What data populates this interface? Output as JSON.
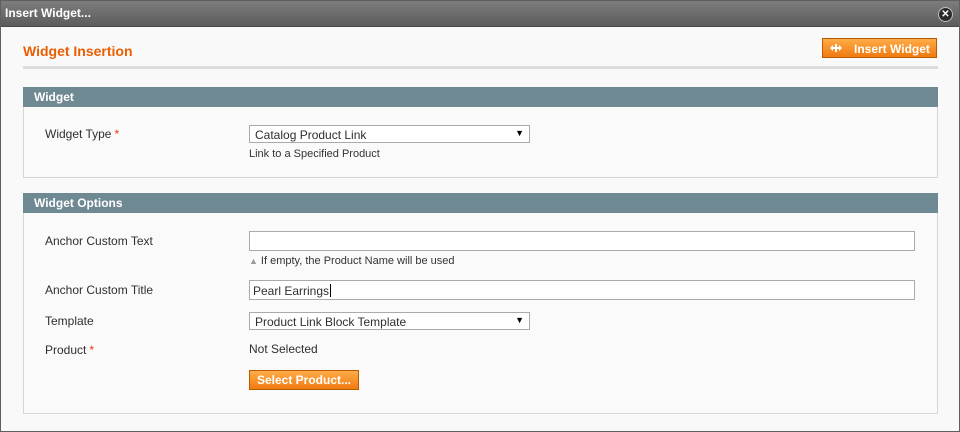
{
  "window": {
    "title": "Insert Widget...",
    "close_icon": "close-icon"
  },
  "header": {
    "title": "Widget Insertion",
    "insert_button_label": "Insert Widget",
    "insert_icon": "move-arrows-icon"
  },
  "widget_section": {
    "title": "Widget",
    "widget_type_label": "Widget Type",
    "required_mark": "*",
    "widget_type_value": "Catalog Product Link",
    "widget_type_note": "Link to a Specified Product"
  },
  "options_section": {
    "title": "Widget Options",
    "anchor_text_label": "Anchor Custom Text",
    "anchor_text_value": "",
    "anchor_text_note": "If empty, the Product Name will be used",
    "anchor_title_label": "Anchor Custom Title",
    "anchor_title_value": "Pearl Earrings",
    "template_label": "Template",
    "template_value": "Product Link Block Template",
    "product_label": "Product",
    "required_mark": "*",
    "product_value": "Not Selected",
    "select_product_label": "Select Product..."
  },
  "colors": {
    "accent": "#eb5e00",
    "section_header": "#6f8992",
    "button": "#f07a10"
  }
}
